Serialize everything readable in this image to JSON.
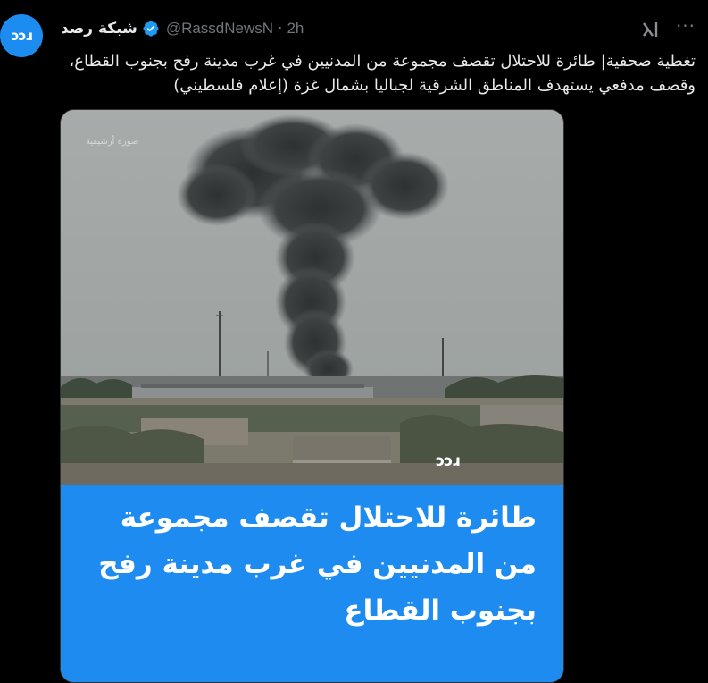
{
  "avatar": {
    "logo_text": "ɔɔɹ"
  },
  "header": {
    "display_name": "شبكة رصد",
    "handle": "@RassdNewsN",
    "separator": "·",
    "time": "2h",
    "more_label": "···"
  },
  "tweet": {
    "text": "تغطية صحفية| طائرة للاحتلال تقصف مجموعة من المدنيين في غرب مدينة رفح بجنوب القطاع، وقصف مدفعي يستهدف المناطق الشرقية لجباليا بشمال غزة (إعلام فلسطيني)"
  },
  "media": {
    "watermark": "صورة أرشيفية",
    "brand_logo": "ɔɔɹ",
    "headline": [
      "طائرة للاحتلال تقصف مجموعة",
      "من المدنيين في غرب مدينة رفح",
      "بجنوب القطاع"
    ],
    "panel_color": "#1d8bef"
  },
  "colors": {
    "accent": "#1d9bf0",
    "background": "#000000",
    "muted": "#71767b"
  },
  "icons": {
    "verified": "verified-badge-icon",
    "grok": "grok-icon",
    "more": "more-icon"
  }
}
